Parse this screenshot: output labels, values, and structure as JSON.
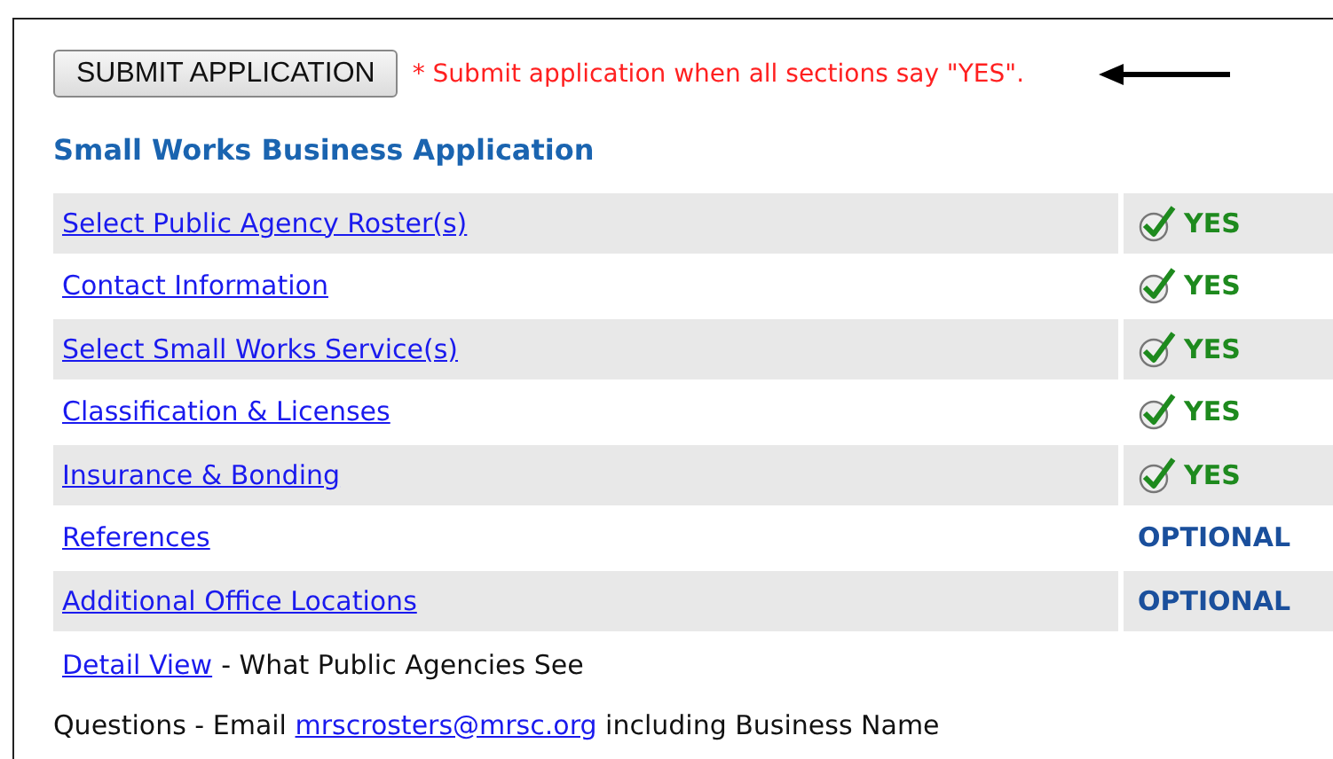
{
  "submit_button": "SUBMIT APPLICATION",
  "submit_note": "* Submit application when all sections say \"YES\".",
  "title": "Small Works Business Application",
  "sections": [
    {
      "label": "Select Public Agency Roster(s)",
      "status": "YES",
      "kind": "complete"
    },
    {
      "label": "Contact Information",
      "status": "YES",
      "kind": "complete"
    },
    {
      "label": "Select Small Works Service(s)",
      "status": "YES",
      "kind": "complete"
    },
    {
      "label": "Classification & Licenses",
      "status": "YES",
      "kind": "complete"
    },
    {
      "label": "Insurance & Bonding",
      "status": "YES",
      "kind": "complete"
    },
    {
      "label": "References",
      "status": "OPTIONAL",
      "kind": "optional"
    },
    {
      "label": "Additional Office Locations",
      "status": "OPTIONAL",
      "kind": "optional"
    }
  ],
  "detail": {
    "link": "Detail View",
    "text": "- What Public Agencies See"
  },
  "questions": {
    "before": "Questions - Email",
    "email": "mrscrosters@mrsc.org",
    "after": "including Business Name"
  }
}
